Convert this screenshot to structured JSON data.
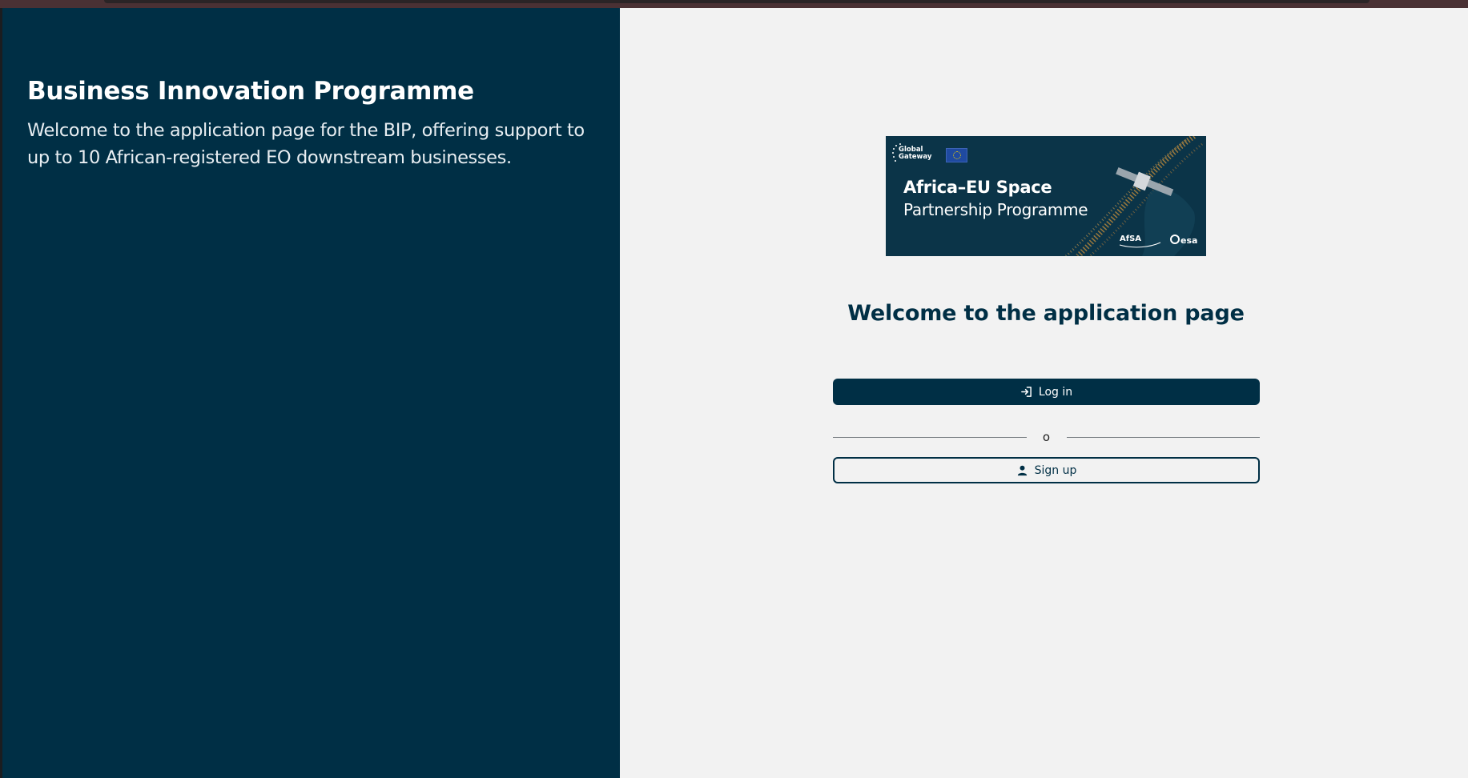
{
  "left_panel": {
    "heading": "Business Innovation Programme",
    "intro": "Welcome to the application page for the BIP, offering support to up to 10 African-registered EO downstream businesses.",
    "background": "#002f45"
  },
  "banner": {
    "gateway_label": "Global\nGateway",
    "title_line1": "Africa–EU Space",
    "title_line2": "Partnership Programme",
    "partner_logo_1": "AfSA",
    "partner_logo_2": "esa"
  },
  "main": {
    "welcome_title": "Welcome to the application page",
    "login_label": "Log in",
    "divider_text": "o",
    "signup_label": "Sign up"
  },
  "icons": {
    "login": "login-arrow-icon",
    "signup": "person-icon"
  },
  "colors": {
    "primary": "#002f45",
    "page_background": "#f2f2f2",
    "banner_background": "#0b3448",
    "window_frame": "#4a3134"
  }
}
